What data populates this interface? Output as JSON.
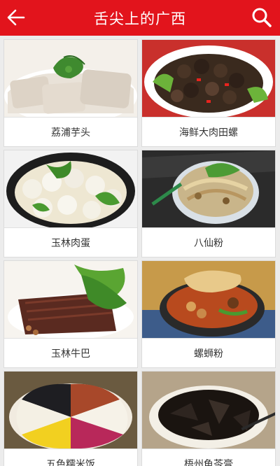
{
  "app_bar": {
    "title": "舌尖上的广西",
    "back_icon": "arrow-left-icon",
    "search_icon": "search-icon",
    "color": "#e2141c"
  },
  "dishes": [
    {
      "name": "荔浦芋头"
    },
    {
      "name": "海鲜大肉田螺"
    },
    {
      "name": "玉林肉蛋"
    },
    {
      "name": "八仙粉"
    },
    {
      "name": "玉林牛巴"
    },
    {
      "name": "螺蛳粉"
    },
    {
      "name": "五色糯米饭"
    },
    {
      "name": "梧州龟苓膏"
    }
  ]
}
